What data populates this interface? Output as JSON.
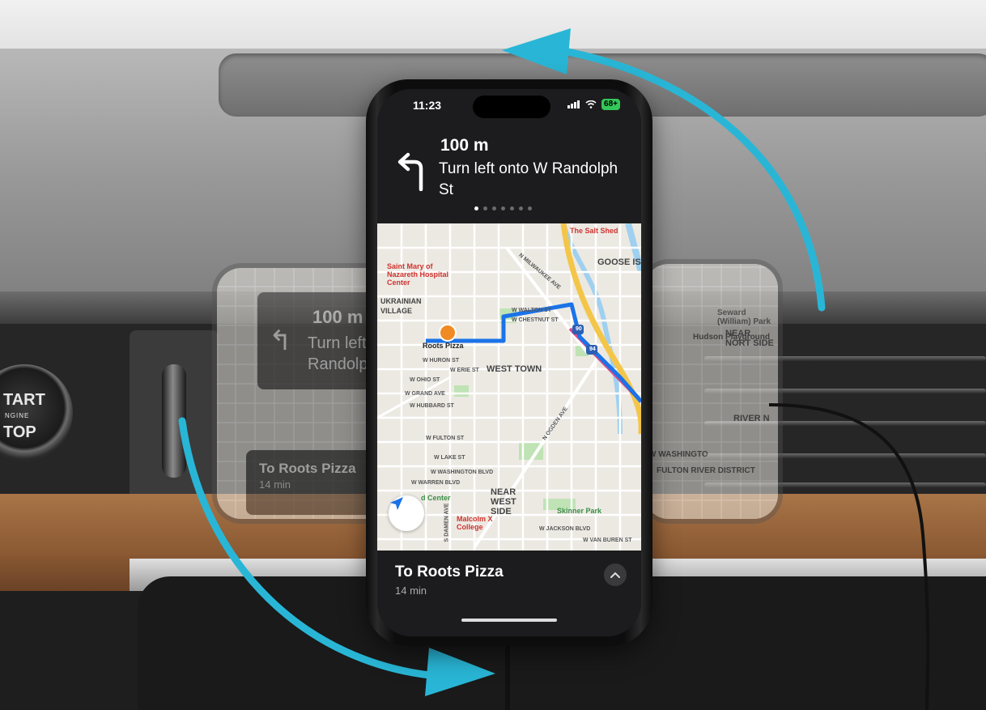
{
  "phone": {
    "status_time": "11:23",
    "battery": "68+",
    "nav": {
      "distance": "100 m",
      "instruction": "Turn left onto W Randolph St",
      "page_dots": 7,
      "active_dot": 0
    },
    "map": {
      "labels": {
        "salt_shed": "The Salt Shed",
        "goose_isl": "GOOSE ISL",
        "st_mary": "Saint Mary of Nazareth Hospital Center",
        "ukrainian": "UKRAINIAN VILLAGE",
        "roots_pizza": "Roots Pizza",
        "west_town": "WEST TOWN",
        "near_west": "NEAR WEST SIDE",
        "skinner": "Skinner Park",
        "malcolm": "Malcolm X College",
        "rd_center": "d Center",
        "w_walton": "W WALTON ST",
        "w_chestnut": "W CHESTNUT ST",
        "w_huron": "W HURON ST",
        "w_erie": "W ERIE ST",
        "w_ohio": "W OHIO ST",
        "w_grand": "W GRAND AVE",
        "w_hubbard": "W HUBBARD ST",
        "w_fulton": "W FULTON ST",
        "w_lake": "W LAKE ST",
        "w_washington": "W WASHINGTON BLVD",
        "w_warren": "W WARREN BLVD",
        "w_jackson": "W JACKSON BLVD",
        "w_van_buren": "W VAN BUREN ST",
        "milwaukee": "N MILWAUKEE AVE",
        "ogden": "N OGDEN AVE",
        "damen": "S DAMEN AVE",
        "i90": "90",
        "i94": "94"
      }
    },
    "destination": "To Roots Pizza",
    "eta": "14 min"
  },
  "ghost_left": {
    "distance": "100 m",
    "instruction": "Turn left Randolp",
    "destination": "To Roots Pizza",
    "eta": "14 min"
  },
  "ghost_right": {
    "labels": {
      "seward": "Seward (William) Park",
      "hudson": "Hudson Playground",
      "near_north": "NEAR NORT SIDE",
      "river_n": "RIVER N",
      "fulton": "FULTON RIVER DISTRICT",
      "w_washingto": "W WASHINGTO"
    }
  },
  "dashboard": {
    "start_line1": "TART",
    "start_line2": "NGINE",
    "start_line3": "TOP"
  },
  "colors": {
    "rotate_arrow": "#29b6d6",
    "route": "#1a73e8",
    "battery": "#34c759"
  },
  "icons": {
    "turn_left": "turn-left-arrow-icon",
    "location": "location-arrow-icon",
    "chevron_up": "chevron-up-icon",
    "wifi": "wifi-icon",
    "signal": "signal-icon"
  }
}
